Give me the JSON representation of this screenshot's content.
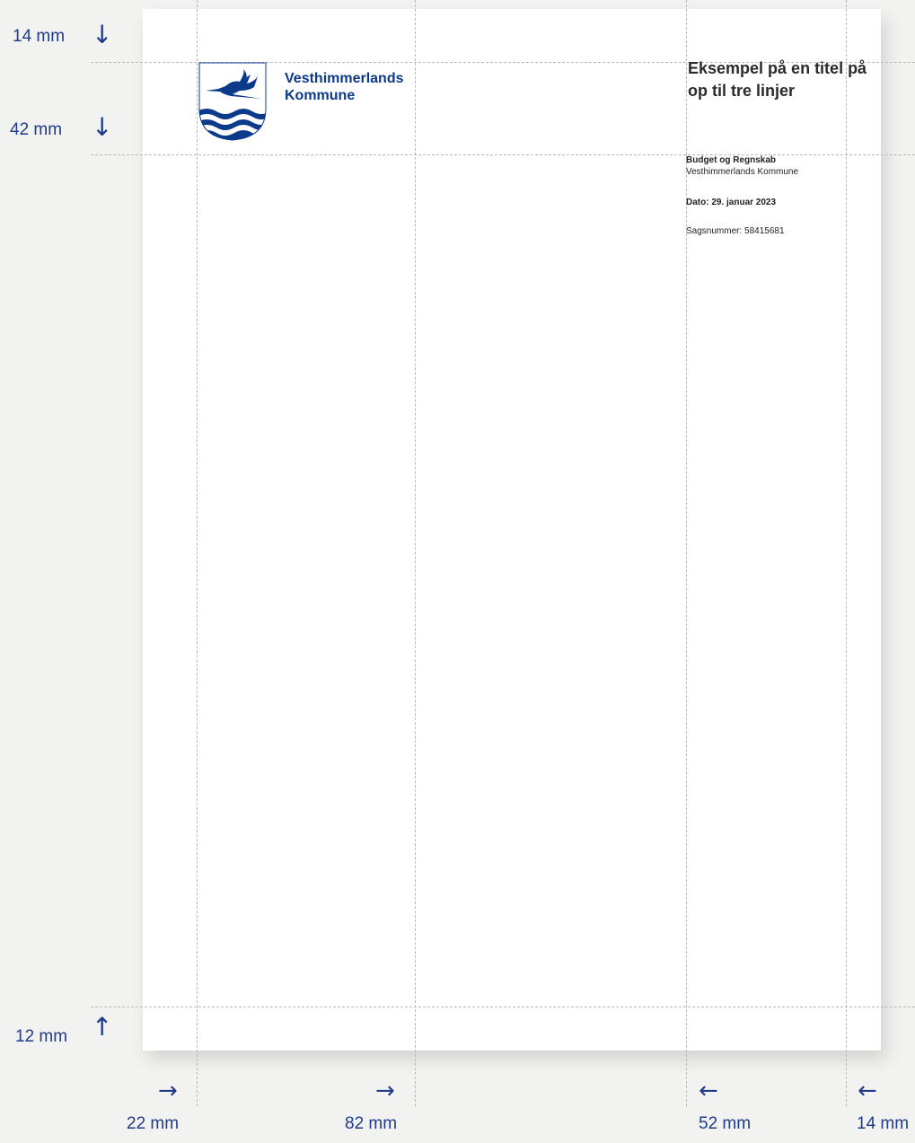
{
  "logo": {
    "name_line1": "Vesthimmerlands",
    "name_line2": "Kommune",
    "icon": "heron-over-waves-shield-icon"
  },
  "document": {
    "title": "Eksempel på en titel på op til tre linjer",
    "department": "Budget og Regnskab",
    "organization": "Vesthimmerlands Kommune",
    "date": "Dato: 29. januar 2023",
    "case_number": "Sagsnummer: 58415681"
  },
  "measurements": {
    "top_margin": "14 mm",
    "header_height": "42 mm",
    "bottom_margin": "12 mm",
    "left_margin": "22 mm",
    "left_column": "82 mm",
    "right_column": "52 mm",
    "right_margin": "14 mm"
  },
  "colors": {
    "brand_blue": "#0b3a8a",
    "guide_label": "#1f3c8a",
    "guide_line": "#b9b9b9"
  }
}
